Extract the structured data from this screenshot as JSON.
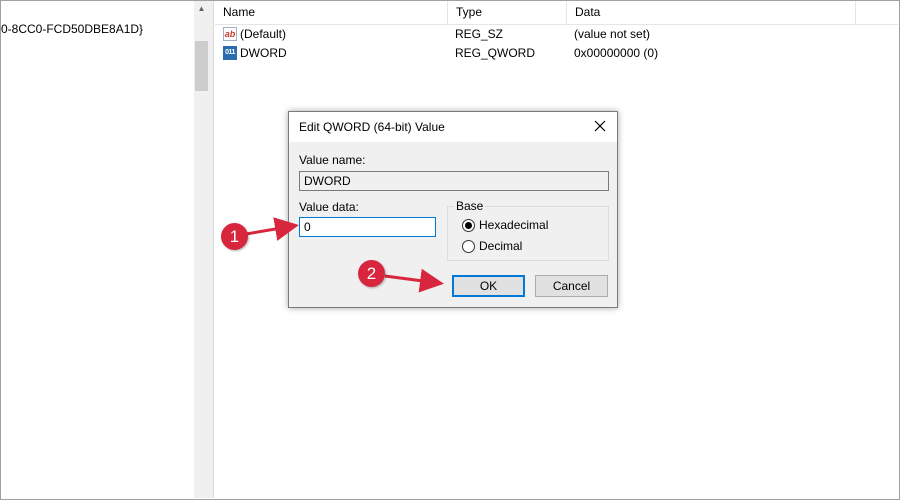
{
  "tree": {
    "truncated_key": "0-8CC0-FCD50DBE8A1D}"
  },
  "list": {
    "columns": [
      "Name",
      "Type",
      "Data"
    ],
    "rows": [
      {
        "icon": "string-value-icon",
        "glyph": "ab",
        "name": "(Default)",
        "type": "REG_SZ",
        "data": "(value not set)"
      },
      {
        "icon": "binary-value-icon",
        "glyph": "011",
        "name": "DWORD",
        "type": "REG_QWORD",
        "data": "0x00000000 (0)"
      }
    ]
  },
  "dialog": {
    "title": "Edit QWORD (64-bit) Value",
    "value_name_label": "Value name:",
    "value_name": "DWORD",
    "value_data_label": "Value data:",
    "value_data": "0",
    "base_title": "Base",
    "base_options": [
      "Hexadecimal",
      "Decimal"
    ],
    "base_selected": "Hexadecimal",
    "ok_label": "OK",
    "cancel_label": "Cancel"
  },
  "annotations": {
    "step1": "1",
    "step2": "2",
    "color": "#d7263d"
  }
}
